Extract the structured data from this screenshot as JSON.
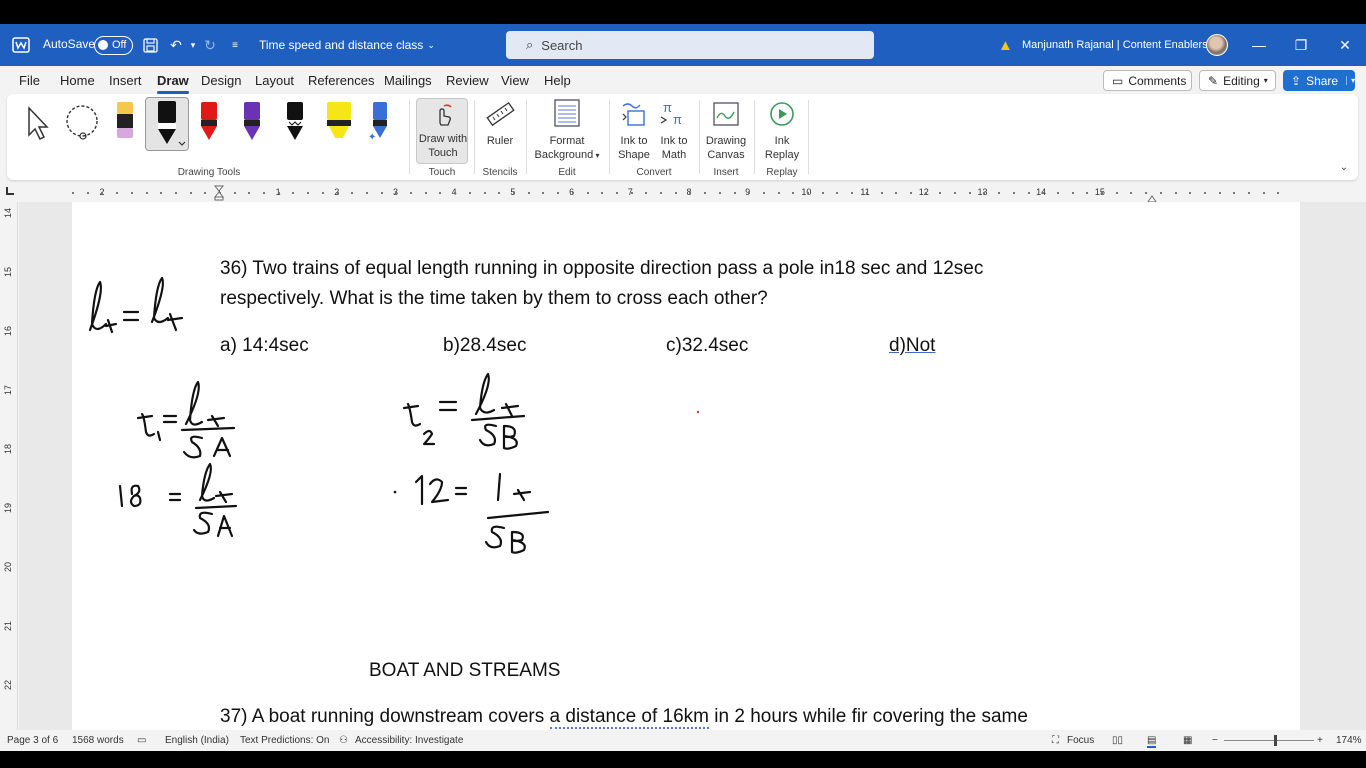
{
  "titlebar": {
    "autosave_label": "AutoSave",
    "autosave_state": "Off",
    "doc_title": "Time speed and distance class",
    "search_placeholder": "Search",
    "user": "Manjunath Rajanal | Content Enablers",
    "accent": "#1f5fbf"
  },
  "menu": {
    "tabs": [
      "File",
      "Home",
      "Insert",
      "Draw",
      "Design",
      "Layout",
      "References",
      "Mailings",
      "Review",
      "View",
      "Help"
    ],
    "active": "Draw",
    "comments": "Comments",
    "editing": "Editing",
    "share": "Share"
  },
  "ribbon": {
    "draw_with_touch": "Draw with Touch",
    "ruler": "Ruler",
    "format_background": "Format Background",
    "ink_to_shape": "Ink to Shape",
    "ink_to_math": "Ink to Math",
    "drawing_canvas": "Drawing Canvas",
    "ink_replay": "Ink Replay",
    "groups": {
      "drawing_tools": "Drawing Tools",
      "touch": "Touch",
      "stencils": "Stencils",
      "edit": "Edit",
      "convert": "Convert",
      "insert": "Insert",
      "replay": "Replay"
    }
  },
  "ruler": {
    "h_numbers": [
      "2",
      "1",
      "1",
      "2",
      "3",
      "4",
      "5",
      "6",
      "7",
      "8",
      "9",
      "10",
      "11",
      "12",
      "13",
      "14",
      "15"
    ],
    "v_numbers": [
      "14",
      "15",
      "16",
      "17",
      "18",
      "19",
      "20",
      "21",
      "22"
    ]
  },
  "document": {
    "q36_line1": "36) Two trains of equal length running in opposite direction pass a pole in18 sec and 12sec",
    "q36_line2": "respectively. What is the time taken by them to cross each other?",
    "opt_a": "a) 14:4sec",
    "opt_b": "b)28.4sec",
    "opt_c": "c)32.4sec",
    "opt_d": "d)Not",
    "heading": "BOAT AND STREAMS",
    "q37_pre": "37) A boat running downstream covers ",
    "q37_link": "a distance of 16km",
    "q37_post": " in 2 hours while fir covering the same"
  },
  "status": {
    "page": "Page 3 of 6",
    "words": "1568 words",
    "language": "English (India)",
    "predictions": "Text Predictions: On",
    "accessibility": "Accessibility: Investigate",
    "focus": "Focus",
    "zoom": "174%"
  }
}
